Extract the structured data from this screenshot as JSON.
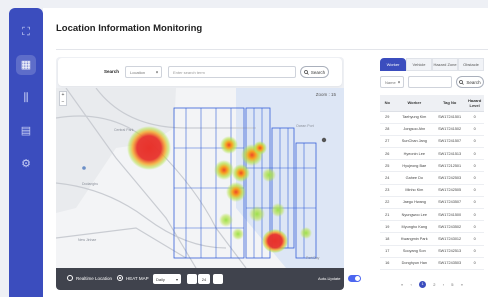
{
  "sidebar": {
    "items": [
      {
        "icon": "grid-icon",
        "glyph": "⛶",
        "active": false
      },
      {
        "icon": "location-dashboard-icon",
        "glyph": "▦",
        "active": true
      },
      {
        "icon": "sliders-icon",
        "glyph": "⫼",
        "active": false
      },
      {
        "icon": "document-icon",
        "glyph": "▤",
        "active": false
      },
      {
        "icon": "gear-icon",
        "glyph": "⚙",
        "active": false
      }
    ]
  },
  "page": {
    "title": "Location Information Monitoring"
  },
  "search": {
    "label": "Search",
    "category_value": "Location",
    "placeholder": "Enter search term",
    "button_label": "Search"
  },
  "map": {
    "zoom_label": "Zoom : 15",
    "place_labels": [
      "Dodanghu",
      "Central Park",
      "New Jinhae",
      "Ocean Port",
      "Port Bay"
    ]
  },
  "bottom_bar": {
    "realtime_label": "Realtime Location",
    "heatmap_label": "HEAT MAP",
    "period_value": "Daily",
    "step_value": "24",
    "auto_update_label": "Auto-Update"
  },
  "tabs": [
    {
      "label": "Worker",
      "active": true
    },
    {
      "label": "Vehicle",
      "active": false
    },
    {
      "label": "Hazard Zone",
      "active": false
    },
    {
      "label": "Obstacle",
      "active": false
    }
  ],
  "filter": {
    "field_value": "Name",
    "button_label": "Search"
  },
  "table": {
    "headers": [
      "No",
      "Worker",
      "Tag No",
      "Hazard Level"
    ],
    "rows": [
      [
        "29",
        "Taehyung Kim",
        "SW17241501",
        "0"
      ],
      [
        "28",
        "Jongsoo Ahn",
        "SW17241502",
        "0"
      ],
      [
        "27",
        "SunChan Jang",
        "SW17241507",
        "0"
      ],
      [
        "26",
        "Hyeonin Lee",
        "SW17241513",
        "0"
      ],
      [
        "25",
        "Hyujeong Bae",
        "SW17212501",
        "0"
      ],
      [
        "24",
        "Gahee Do",
        "SW17242503",
        "0"
      ],
      [
        "23",
        "Minho Kim",
        "SW17242505",
        "0"
      ],
      [
        "22",
        "Jaegu Hwang",
        "SW17243507",
        "0"
      ],
      [
        "21",
        "Nyungwoo Lee",
        "SW17241500",
        "0"
      ],
      [
        "19",
        "Myungho Kang",
        "SW17243502",
        "0"
      ],
      [
        "18",
        "Kwangmin Park",
        "SW17243012",
        "0"
      ],
      [
        "17",
        "Sooyang Son",
        "SW17242513",
        "0"
      ],
      [
        "16",
        "Donghyun Han",
        "SW17243503",
        "0"
      ]
    ]
  },
  "pagination": {
    "first": "«",
    "prev": "‹",
    "pages": [
      "1",
      "2"
    ],
    "current": "1",
    "next": "›",
    "last_num": "5",
    "last": "»"
  },
  "colors": {
    "accent": "#3b4dbe",
    "heat_hot": "#e8322b",
    "heat_warm": "#f5a623",
    "heat_cool": "#b8e34a"
  }
}
